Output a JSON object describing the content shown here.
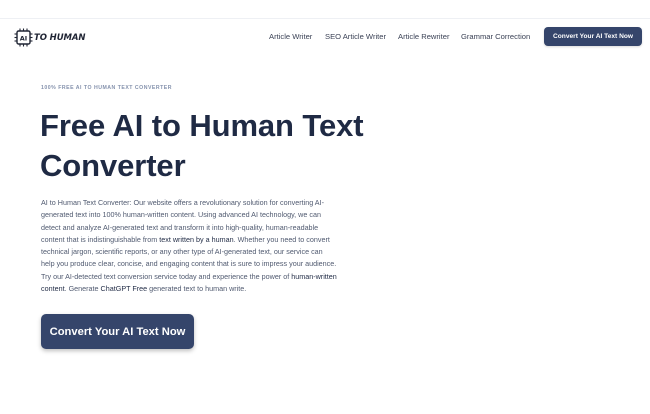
{
  "header": {
    "logo_text": "TO HUMAN",
    "logo_chip_text": "AI",
    "nav": [
      {
        "label": "Article Writer"
      },
      {
        "label": "SEO Article Writer"
      },
      {
        "label": "Article Rewriter"
      },
      {
        "label": "Grammar Correction"
      }
    ],
    "cta_label": "Convert Your AI Text Now"
  },
  "hero": {
    "eyebrow": "100% FREE AI TO HUMAN TEXT CONVERTER",
    "title_line1": "Free AI to Human Text",
    "title_line2": "Converter",
    "description": {
      "part1": "AI to Human Text Converter: Our website offers a revolutionary solution for converting AI-generated text into 100% human-written content. Using advanced AI technology, we can detect and analyze AI-generated text and transform it into high-quality, human-readable content that is indistinguishable from ",
      "link1": "text written by a human",
      "part2": ". Whether you need to convert technical jargon, scientific reports, or any other type of AI-generated text, our service can help you produce clear, concise, and engaging content that is sure to impress your audience. Try our AI-detected text conversion service today and experience the power of ",
      "link2": "human-written content",
      "part3": ". Generate ",
      "link3": "ChatGPT Free",
      "part4": " generated text to human write."
    },
    "cta_label": "Convert Your AI Text Now"
  },
  "colors": {
    "primary_button": "#35456b",
    "heading": "#1f2a44",
    "body_text": "#505a70",
    "eyebrow": "#8592ad"
  },
  "icons": {
    "logo": "ai-chip-icon"
  }
}
